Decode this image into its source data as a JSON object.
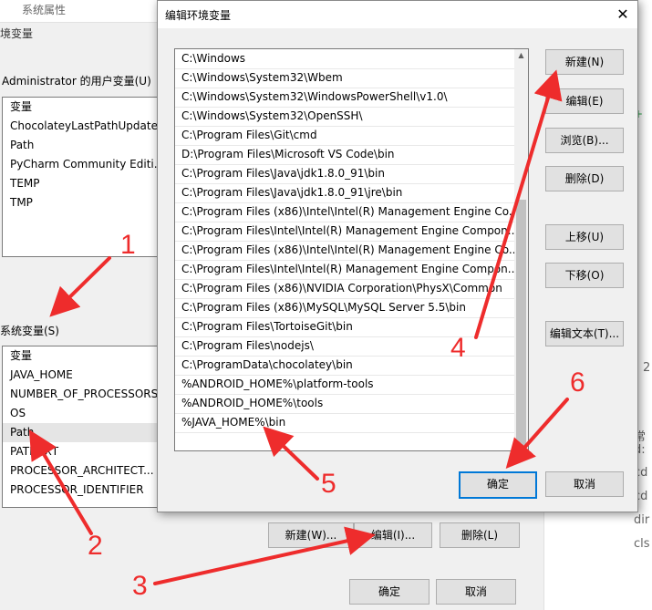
{
  "background_window": {
    "tab_title": "系统属性",
    "subtitle": "境变量",
    "user_vars_label": "Administrator 的用户变量(U)",
    "user_vars_header": "变量",
    "user_vars": [
      "ChocolateyLastPathUpdate",
      "Path",
      "PyCharm Community Editi...",
      "TEMP",
      "TMP"
    ],
    "system_vars_label": "系统变量(S)",
    "system_vars_header": "变量",
    "system_vars": [
      "JAVA_HOME",
      "NUMBER_OF_PROCESSORS",
      "OS",
      "Path",
      "PATHEXT",
      "PROCESSOR_ARCHITECT...",
      "PROCESSOR_IDENTIFIER"
    ],
    "selected_system_var": "Path",
    "new_button": "新建(W)...",
    "edit_button": "编辑(I)...",
    "delete_button": "删除(L)",
    "ok_button": "确定",
    "cancel_button": "取消"
  },
  "right_panel": {
    "fragments": [
      "2",
      ". 常",
      "d:",
      "cd",
      "cd",
      "dir",
      "cls"
    ]
  },
  "dialog": {
    "title": "编辑环境变量",
    "close_glyph": "✕",
    "paths": [
      "C:\\Windows",
      "C:\\Windows\\System32\\Wbem",
      "C:\\Windows\\System32\\WindowsPowerShell\\v1.0\\",
      "C:\\Windows\\System32\\OpenSSH\\",
      "C:\\Program Files\\Git\\cmd",
      "D:\\Program Files\\Microsoft VS Code\\bin",
      "C:\\Program Files\\Java\\jdk1.8.0_91\\bin",
      "C:\\Program Files\\Java\\jdk1.8.0_91\\jre\\bin",
      "C:\\Program Files (x86)\\Intel\\Intel(R) Management Engine Co...",
      "C:\\Program Files\\Intel\\Intel(R) Management Engine Compon...",
      "C:\\Program Files (x86)\\Intel\\Intel(R) Management Engine Co...",
      "C:\\Program Files\\Intel\\Intel(R) Management Engine Compon...",
      "C:\\Program Files (x86)\\NVIDIA Corporation\\PhysX\\Common",
      "C:\\Program Files (x86)\\MySQL\\MySQL Server 5.5\\bin",
      "C:\\Program Files\\TortoiseGit\\bin",
      "C:\\Program Files\\nodejs\\",
      "C:\\ProgramData\\chocolatey\\bin",
      "%ANDROID_HOME%\\platform-tools",
      "%ANDROID_HOME%\\tools",
      "%JAVA_HOME%\\bin"
    ],
    "buttons": {
      "new": "新建(N)",
      "edit": "编辑(E)",
      "browse": "浏览(B)...",
      "delete": "删除(D)",
      "move_up": "上移(U)",
      "move_down": "下移(O)",
      "edit_text": "编辑文本(T)...",
      "ok": "确定",
      "cancel": "取消"
    }
  },
  "annotations": {
    "color": "#ee2c2c",
    "labels": [
      "1",
      "2",
      "3",
      "4",
      "5",
      "6"
    ]
  }
}
